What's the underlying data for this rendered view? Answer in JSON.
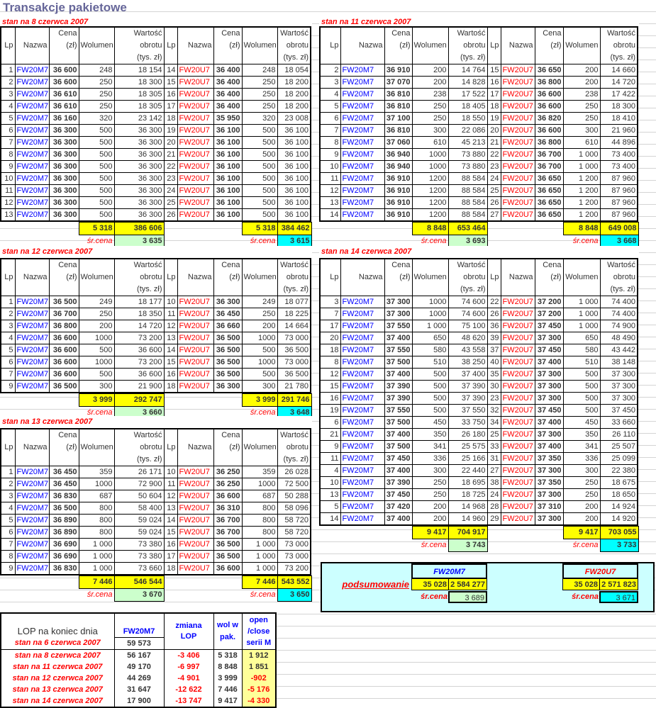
{
  "title": "Transakcje pakietowe",
  "headers": {
    "lp": "Lp",
    "nazwa": "Nazwa",
    "cena1": "Cena",
    "cena2": "(zł)",
    "wolumen": "Wolumen",
    "wart1": "Wartość",
    "wart2": "obrotu",
    "wart3": "(tys. zł)"
  },
  "avg_label": "śr.cena",
  "colors": {
    "m7": "#0000ff",
    "u7": "#ff0000",
    "sum": "#ffff00",
    "avg_m7": "#ccffcc",
    "avg_u7": "#00ffff"
  },
  "sections": [
    {
      "title": "stan na 8 czerwca 2007",
      "left": {
        "rows": [
          [
            "1",
            "FW20M7",
            "36 600",
            "248",
            "18 154"
          ],
          [
            "2",
            "FW20M7",
            "36 600",
            "250",
            "18 300"
          ],
          [
            "3",
            "FW20M7",
            "36 610",
            "250",
            "18 305"
          ],
          [
            "4",
            "FW20M7",
            "36 610",
            "250",
            "18 305"
          ],
          [
            "5",
            "FW20M7",
            "36 160",
            "320",
            "23 142"
          ],
          [
            "6",
            "FW20M7",
            "36 300",
            "500",
            "36 300"
          ],
          [
            "7",
            "FW20M7",
            "36 300",
            "500",
            "36 300"
          ],
          [
            "8",
            "FW20M7",
            "36 300",
            "500",
            "36 300"
          ],
          [
            "9",
            "FW20M7",
            "36 300",
            "500",
            "36 300"
          ],
          [
            "10",
            "FW20M7",
            "36 300",
            "500",
            "36 300"
          ],
          [
            "11",
            "FW20M7",
            "36 300",
            "500",
            "36 300"
          ],
          [
            "12",
            "FW20M7",
            "36 300",
            "500",
            "36 300"
          ],
          [
            "13",
            "FW20M7",
            "36 300",
            "500",
            "36 300"
          ]
        ],
        "sum_vol": "5 318",
        "sum_val": "386 606",
        "avg": "3 635"
      },
      "right": {
        "rows": [
          [
            "14",
            "FW20U7",
            "36 400",
            "248",
            "18 054"
          ],
          [
            "15",
            "FW20U7",
            "36 400",
            "250",
            "18 200"
          ],
          [
            "16",
            "FW20U7",
            "36 400",
            "250",
            "18 200"
          ],
          [
            "17",
            "FW20U7",
            "36 400",
            "250",
            "18 200"
          ],
          [
            "18",
            "FW20U7",
            "35 950",
            "320",
            "23 008"
          ],
          [
            "19",
            "FW20U7",
            "36 100",
            "500",
            "36 100"
          ],
          [
            "20",
            "FW20U7",
            "36 100",
            "500",
            "36 100"
          ],
          [
            "21",
            "FW20U7",
            "36 100",
            "500",
            "36 100"
          ],
          [
            "22",
            "FW20U7",
            "36 100",
            "500",
            "36 100"
          ],
          [
            "23",
            "FW20U7",
            "36 100",
            "500",
            "36 100"
          ],
          [
            "24",
            "FW20U7",
            "36 100",
            "500",
            "36 100"
          ],
          [
            "25",
            "FW20U7",
            "36 100",
            "500",
            "36 100"
          ],
          [
            "26",
            "FW20U7",
            "36 100",
            "500",
            "36 100"
          ]
        ],
        "sum_vol": "5 318",
        "sum_val": "384 462",
        "avg": "3 615"
      }
    },
    {
      "title": "stan na 11 czerwca 2007",
      "left": {
        "rows": [
          [
            "2",
            "FW20M7",
            "36 910",
            "200",
            "14 764"
          ],
          [
            "3",
            "FW20M7",
            "37 070",
            "200",
            "14 828"
          ],
          [
            "4",
            "FW20M7",
            "36 810",
            "238",
            "17 522"
          ],
          [
            "5",
            "FW20M7",
            "36 810",
            "250",
            "18 405"
          ],
          [
            "6",
            "FW20M7",
            "37 100",
            "250",
            "18 550"
          ],
          [
            "7",
            "FW20M7",
            "36 810",
            "300",
            "22 086"
          ],
          [
            "8",
            "FW20M7",
            "37 060",
            "610",
            "45 213"
          ],
          [
            "9",
            "FW20M7",
            "36 940",
            "1000",
            "73 880"
          ],
          [
            "10",
            "FW20M7",
            "36 940",
            "1000",
            "73 880"
          ],
          [
            "11",
            "FW20M7",
            "36 910",
            "1200",
            "88 584"
          ],
          [
            "12",
            "FW20M7",
            "36 910",
            "1200",
            "88 584"
          ],
          [
            "13",
            "FW20M7",
            "36 910",
            "1200",
            "88 584"
          ],
          [
            "14",
            "FW20M7",
            "36 910",
            "1200",
            "88 584"
          ]
        ],
        "sum_vol": "8 848",
        "sum_val": "653 464",
        "avg": "3 693"
      },
      "right": {
        "rows": [
          [
            "15",
            "FW20U7",
            "36 650",
            "200",
            "14 660"
          ],
          [
            "16",
            "FW20U7",
            "36 800",
            "200",
            "14 720"
          ],
          [
            "17",
            "FW20U7",
            "36 600",
            "238",
            "17 422"
          ],
          [
            "18",
            "FW20U7",
            "36 600",
            "250",
            "18 300"
          ],
          [
            "19",
            "FW20U7",
            "36 820",
            "250",
            "18 410"
          ],
          [
            "20",
            "FW20U7",
            "36 600",
            "300",
            "21 960"
          ],
          [
            "21",
            "FW20U7",
            "36 800",
            "610",
            "44 896"
          ],
          [
            "22",
            "FW20U7",
            "36 700",
            "1 000",
            "73 400"
          ],
          [
            "23",
            "FW20U7",
            "36 700",
            "1 000",
            "73 400"
          ],
          [
            "24",
            "FW20U7",
            "36 650",
            "1 200",
            "87 960"
          ],
          [
            "25",
            "FW20U7",
            "36 650",
            "1 200",
            "87 960"
          ],
          [
            "26",
            "FW20U7",
            "36 650",
            "1 200",
            "87 960"
          ],
          [
            "27",
            "FW20U7",
            "36 650",
            "1 200",
            "87 960"
          ]
        ],
        "sum_vol": "8 848",
        "sum_val": "649 008",
        "avg": "3 668"
      }
    },
    {
      "title": "stan na 12 czerwca 2007",
      "left": {
        "rows": [
          [
            "1",
            "FW20M7",
            "36 500",
            "249",
            "18 177"
          ],
          [
            "2",
            "FW20M7",
            "36 700",
            "250",
            "18 350"
          ],
          [
            "3",
            "FW20M7",
            "36 800",
            "200",
            "14 720"
          ],
          [
            "4",
            "FW20M7",
            "36 600",
            "1000",
            "73 200"
          ],
          [
            "5",
            "FW20M7",
            "36 600",
            "500",
            "36 600"
          ],
          [
            "6",
            "FW20M7",
            "36 600",
            "1000",
            "73 200"
          ],
          [
            "7",
            "FW20M7",
            "36 600",
            "500",
            "36 600"
          ],
          [
            "9",
            "FW20M7",
            "36 500",
            "300",
            "21 900"
          ]
        ],
        "sum_vol": "3 999",
        "sum_val": "292 747",
        "avg": "3 660"
      },
      "right": {
        "rows": [
          [
            "10",
            "FW20U7",
            "36 300",
            "249",
            "18 077"
          ],
          [
            "11",
            "FW20U7",
            "36 450",
            "250",
            "18 225"
          ],
          [
            "12",
            "FW20U7",
            "36 660",
            "200",
            "14 664"
          ],
          [
            "13",
            "FW20U7",
            "36 500",
            "1000",
            "73 000"
          ],
          [
            "14",
            "FW20U7",
            "36 500",
            "500",
            "36 500"
          ],
          [
            "15",
            "FW20U7",
            "36 500",
            "1000",
            "73 000"
          ],
          [
            "16",
            "FW20U7",
            "36 500",
            "500",
            "36 500"
          ],
          [
            "18",
            "FW20U7",
            "36 300",
            "300",
            "21 780"
          ]
        ],
        "sum_vol": "3 999",
        "sum_val": "291 746",
        "avg": "3 648"
      }
    },
    {
      "title": "stan na 13 czerwca 2007",
      "left": {
        "rows": [
          [
            "1",
            "FW20M7",
            "36 450",
            "359",
            "26 171"
          ],
          [
            "2",
            "FW20M7",
            "36 450",
            "1000",
            "72 900"
          ],
          [
            "3",
            "FW20M7",
            "36 830",
            "687",
            "50 604"
          ],
          [
            "4",
            "FW20M7",
            "36 500",
            "800",
            "58 400"
          ],
          [
            "5",
            "FW20M7",
            "36 890",
            "800",
            "59 024"
          ],
          [
            "6",
            "FW20M7",
            "36 890",
            "800",
            "59 024"
          ],
          [
            "7",
            "FW20M7",
            "36 690",
            "1 000",
            "73 380"
          ],
          [
            "8",
            "FW20M7",
            "36 690",
            "1 000",
            "73 380"
          ],
          [
            "9",
            "FW20M7",
            "36 830",
            "1 000",
            "73 660"
          ]
        ],
        "sum_vol": "7 446",
        "sum_val": "546 544",
        "avg": "3 670"
      },
      "right": {
        "rows": [
          [
            "10",
            "FW20U7",
            "36 250",
            "359",
            "26 028"
          ],
          [
            "11",
            "FW20U7",
            "36 250",
            "1000",
            "72 500"
          ],
          [
            "12",
            "FW20U7",
            "36 600",
            "687",
            "50 288"
          ],
          [
            "13",
            "FW20U7",
            "36 310",
            "800",
            "58 096"
          ],
          [
            "14",
            "FW20U7",
            "36 700",
            "800",
            "58 720"
          ],
          [
            "15",
            "FW20U7",
            "36 700",
            "800",
            "58 720"
          ],
          [
            "16",
            "FW20U7",
            "36 500",
            "1 000",
            "73 000"
          ],
          [
            "17",
            "FW20U7",
            "36 500",
            "1 000",
            "73 000"
          ],
          [
            "18",
            "FW20U7",
            "36 600",
            "1 000",
            "73 200"
          ]
        ],
        "sum_vol": "7 446",
        "sum_val": "543 552",
        "avg": "3 650"
      }
    },
    {
      "title": "stan na 14 czerwca 2007",
      "left": {
        "rows": [
          [
            "3",
            "FW20M7",
            "37 300",
            "1000",
            "74 600"
          ],
          [
            "7",
            "FW20M7",
            "37 300",
            "1000",
            "74 600"
          ],
          [
            "17",
            "FW20M7",
            "37 550",
            "1 000",
            "75 100"
          ],
          [
            "20",
            "FW20M7",
            "37 400",
            "650",
            "48 620"
          ],
          [
            "18",
            "FW20M7",
            "37 550",
            "580",
            "43 558"
          ],
          [
            "8",
            "FW20M7",
            "37 500",
            "510",
            "38 250"
          ],
          [
            "12",
            "FW20M7",
            "37 400",
            "500",
            "37 400"
          ],
          [
            "15",
            "FW20M7",
            "37 390",
            "500",
            "37 390"
          ],
          [
            "16",
            "FW20M7",
            "37 390",
            "500",
            "37 390"
          ],
          [
            "19",
            "FW20M7",
            "37 550",
            "500",
            "37 550"
          ],
          [
            "6",
            "FW20M7",
            "37 500",
            "450",
            "33 750"
          ],
          [
            "21",
            "FW20M7",
            "37 400",
            "350",
            "26 180"
          ],
          [
            "9",
            "FW20M7",
            "37 500",
            "341",
            "25 575"
          ],
          [
            "11",
            "FW20M7",
            "37 450",
            "336",
            "25 166"
          ],
          [
            "4",
            "FW20M7",
            "37 400",
            "300",
            "22 440"
          ],
          [
            "10",
            "FW20M7",
            "37 390",
            "250",
            "18 695"
          ],
          [
            "13",
            "FW20M7",
            "37 450",
            "250",
            "18 725"
          ],
          [
            "5",
            "FW20M7",
            "37 420",
            "200",
            "14 968"
          ],
          [
            "14",
            "FW20M7",
            "37 400",
            "200",
            "14 960"
          ]
        ],
        "sum_vol": "9 417",
        "sum_val": "704 917",
        "avg": "3 743"
      },
      "right": {
        "rows": [
          [
            "22",
            "FW20U7",
            "37 200",
            "1 000",
            "74 400"
          ],
          [
            "26",
            "FW20U7",
            "37 200",
            "1 000",
            "74 400"
          ],
          [
            "36",
            "FW20U7",
            "37 450",
            "1 000",
            "74 900"
          ],
          [
            "39",
            "FW20U7",
            "37 300",
            "650",
            "48 490"
          ],
          [
            "37",
            "FW20U7",
            "37 450",
            "580",
            "43 442"
          ],
          [
            "40",
            "FW20U7",
            "37 400",
            "510",
            "38 148"
          ],
          [
            "35",
            "FW20U7",
            "37 300",
            "500",
            "37 300"
          ],
          [
            "30",
            "FW20U7",
            "37 300",
            "500",
            "37 300"
          ],
          [
            "23",
            "FW20U7",
            "37 300",
            "500",
            "37 300"
          ],
          [
            "32",
            "FW20U7",
            "37 450",
            "500",
            "37 450"
          ],
          [
            "34",
            "FW20U7",
            "37 400",
            "450",
            "33 660"
          ],
          [
            "25",
            "FW20U7",
            "37 300",
            "350",
            "26 110"
          ],
          [
            "33",
            "FW20U7",
            "37 400",
            "341",
            "25 507"
          ],
          [
            "31",
            "FW20U7",
            "37 350",
            "336",
            "25 099"
          ],
          [
            "27",
            "FW20U7",
            "37 300",
            "300",
            "22 380"
          ],
          [
            "38",
            "FW20U7",
            "37 350",
            "250",
            "18 675"
          ],
          [
            "24",
            "FW20U7",
            "37 300",
            "250",
            "18 650"
          ],
          [
            "28",
            "FW20U7",
            "37 310",
            "200",
            "14 924"
          ],
          [
            "29",
            "FW20U7",
            "37 300",
            "200",
            "14 920"
          ]
        ],
        "sum_vol": "9 417",
        "sum_val": "703 055",
        "avg": "3 733"
      }
    }
  ],
  "summary": {
    "label": "podsumowanie",
    "m7": {
      "name": "FW20M7",
      "vol": "35 028",
      "val": "2 584 277",
      "avg": "3 689"
    },
    "u7": {
      "name": "FW20U7",
      "vol": "35 028",
      "val": "2 571 823",
      "avg": "3 671"
    }
  },
  "lop": {
    "headers": {
      "label": "LOP na koniec dnia",
      "m7": "FW20M7",
      "change": "zmiana LOP",
      "vol": "wol w pak.",
      "oc": "open /close serii M"
    },
    "first": {
      "label": "stan na 6 czerwca 2007",
      "m7": "59 573"
    },
    "rows": [
      {
        "label": "stan na 8 czerwca 2007",
        "m7": "56 167",
        "change": "-3 406",
        "vol": "5 318",
        "oc": "1 912"
      },
      {
        "label": "stan na 11 czerwca 2007",
        "m7": "49 170",
        "change": "-6 997",
        "vol": "8 848",
        "oc": "1 851"
      },
      {
        "label": "stan na 12 czerwca 2007",
        "m7": "44 269",
        "change": "-4 901",
        "vol": "3 999",
        "oc": "-902"
      },
      {
        "label": "stan na 13 czerwca 2007",
        "m7": "31 647",
        "change": "-12 622",
        "vol": "7 446",
        "oc": "-5 176"
      },
      {
        "label": "stan na 14 czerwca 2007",
        "m7": "17 900",
        "change": "-13 747",
        "vol": "9 417",
        "oc": "-4 330"
      }
    ]
  }
}
